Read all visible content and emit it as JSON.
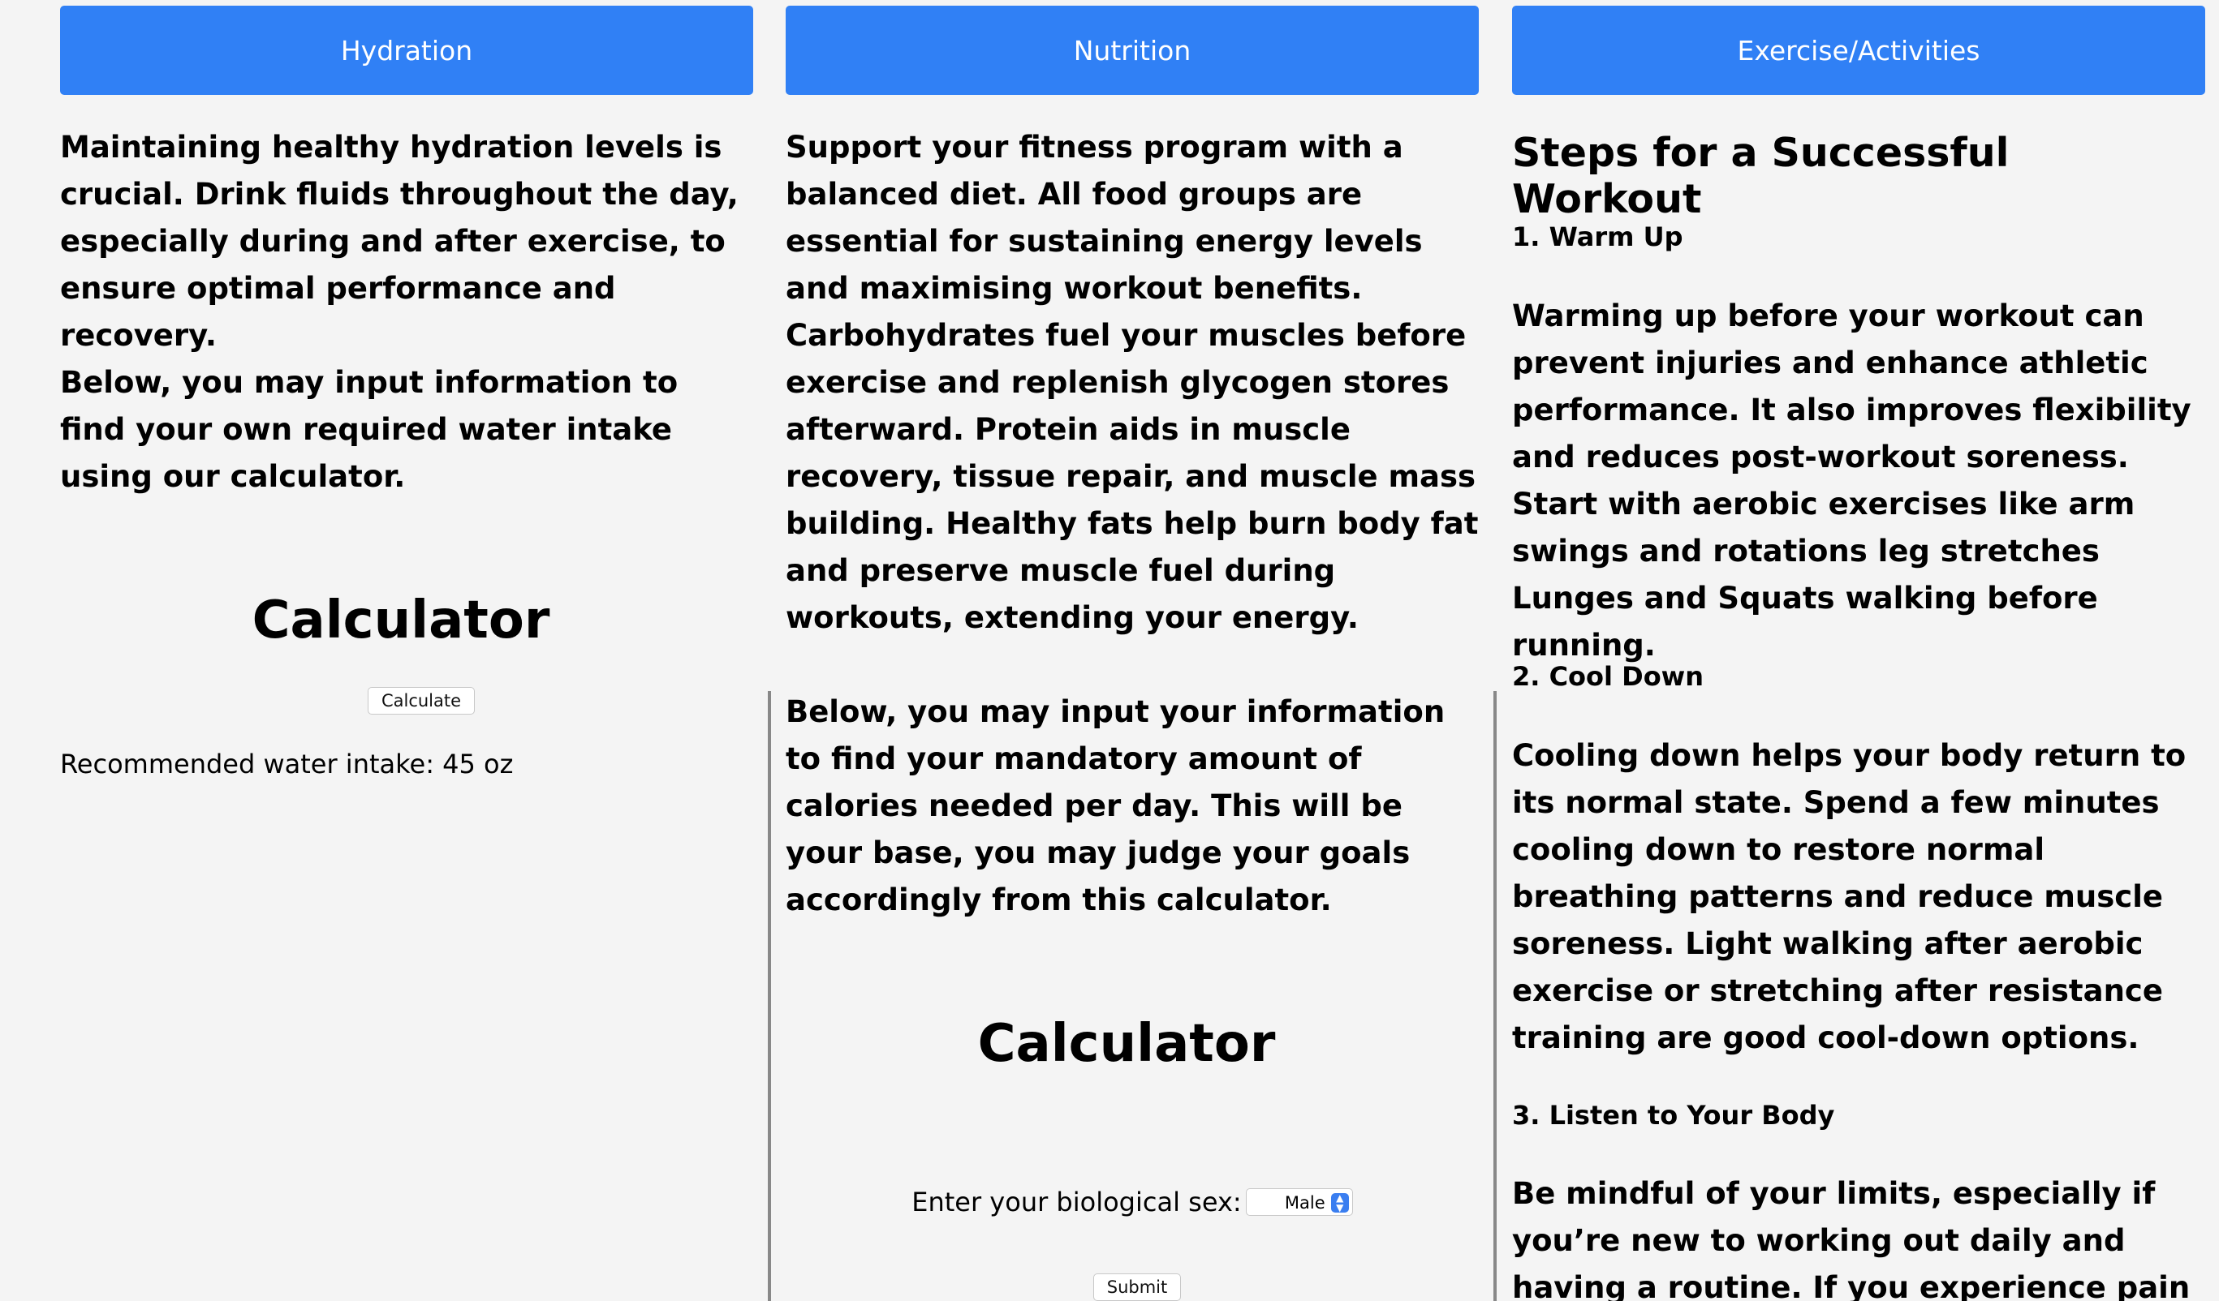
{
  "tabs": {
    "hydration": "Hydration",
    "nutrition": "Nutrition",
    "exercise": "Exercise/Activities"
  },
  "hydration": {
    "intro": "Maintaining healthy hydration levels is crucial. Drink fluids throughout the day, especially during and after exercise, to ensure optimal performance and recovery.",
    "input_note": "Below, you may input information to find your own required water intake using our calculator.",
    "calculator_title": "Calculator",
    "calculate_label": "Calculate",
    "result": "Recommended water intake: 45 oz"
  },
  "nutrition": {
    "intro": "Support your fitness program with a balanced diet. All food groups are essential for sustaining energy levels and maximising workout benefits. Carbohydrates fuel your muscles before exercise and replenish glycogen stores afterward. Protein aids in muscle recovery, tissue repair, and muscle mass building. Healthy fats help burn body fat and preserve muscle fuel during workouts, extending your energy.",
    "input_note": "Below, you may input your information to find your mandatory amount of calories needed per day. This will be your base, you may judge your goals accordingly from this calculator.",
    "calculator_title": "Calculator",
    "sex_label": "Enter your biological sex:",
    "sex_value": "Male",
    "submit_label": "Submit"
  },
  "exercise": {
    "heading": "Steps for a Successful Workout",
    "step1_title": "1. Warm Up",
    "step1_text": "Warming up before your workout can prevent injuries and enhance athletic performance. It also improves flexibility and reduces post-workout soreness. Start with aerobic exercises like arm swings and rotations leg stretches Lunges and Squats walking before running.",
    "step2_title": "2. Cool Down",
    "step2_text": "Cooling down helps your body return to its normal state. Spend a few minutes cooling down to restore normal breathing patterns and reduce muscle soreness. Light walking after aerobic exercise or stretching after resistance training are good cool-down options.",
    "step3_title": "3. Listen to Your Body",
    "step3_text": "Be mindful of your limits, especially if you’re new to working out daily and having a routine. If you experience pain or"
  },
  "colors": {
    "accent": "#3080f5",
    "background": "#f4f4f4",
    "divider": "#888888"
  }
}
